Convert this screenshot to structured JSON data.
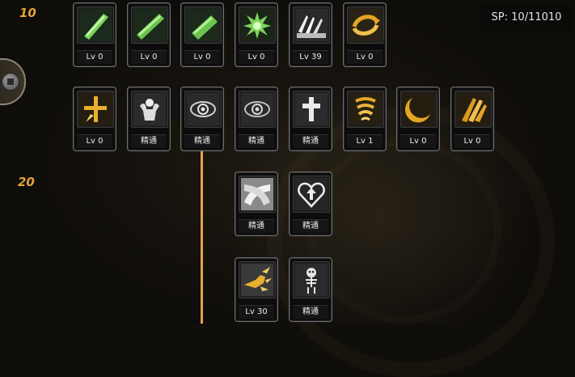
{
  "header": {
    "sp_display": "SP: 10/11010"
  },
  "tiers": [
    {
      "label": "10"
    },
    {
      "label": "20"
    }
  ],
  "skills": [
    {
      "level": "Lv 0",
      "icon": "green-blade-icon"
    },
    {
      "level": "Lv 0",
      "icon": "green-blade-icon"
    },
    {
      "level": "Lv 0",
      "icon": "green-blade-icon"
    },
    {
      "level": "Lv 0",
      "icon": "green-burst-icon"
    },
    {
      "level": "Lv 39",
      "icon": "white-claw-slash-icon"
    },
    {
      "level": "Lv 0",
      "icon": "golden-swirl-icon"
    },
    {
      "level": "Lv 0",
      "icon": "golden-cross-burst-icon"
    },
    {
      "level": "精通",
      "icon": "muscle-flex-icon"
    },
    {
      "level": "精通",
      "icon": "eye-icon"
    },
    {
      "level": "精通",
      "icon": "eye-icon"
    },
    {
      "level": "精通",
      "icon": "cross-icon"
    },
    {
      "level": "Lv 1",
      "icon": "golden-tornado-icon"
    },
    {
      "level": "Lv 0",
      "icon": "golden-crescent-icon"
    },
    {
      "level": "Lv 0",
      "icon": "golden-dash-icon"
    },
    {
      "level": "精通",
      "icon": "crossed-arms-icon"
    },
    {
      "level": "精通",
      "icon": "heart-arrow-icon"
    },
    {
      "level": "Lv 30",
      "icon": "golden-punch-icon"
    },
    {
      "level": "精通",
      "icon": "skeleton-icon"
    }
  ],
  "colors": {
    "accent": "#e6a23a",
    "connector": "#e8a14c",
    "green_skill": "#7fd35a",
    "gold_skill": "#e2a526"
  }
}
